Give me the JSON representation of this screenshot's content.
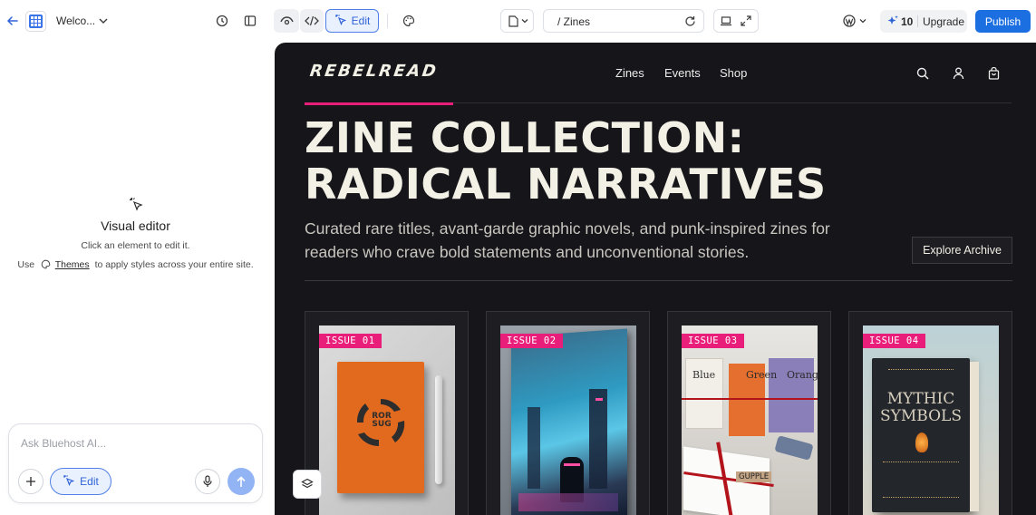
{
  "topbar": {
    "site_name": "Welco...",
    "edit_label": "Edit",
    "url_path": "/ Zines",
    "credits_count": "10",
    "upgrade_label": "Upgrade",
    "publish_label": "Publish",
    "accent_color": "#1c6fe0"
  },
  "left_panel": {
    "title": "Visual editor",
    "subtitle": "Click an element to edit it.",
    "use_prefix": "Use",
    "themes_link": "Themes",
    "use_suffix": "to apply styles across your entire site.",
    "chat_placeholder": "Ask Bluehost AI...",
    "chat_edit_label": "Edit"
  },
  "site": {
    "brand": "REBELREAD",
    "nav": [
      "Zines",
      "Events",
      "Shop"
    ],
    "hero_line1": "ZINE COLLECTION:",
    "hero_line2": "RADICAL NARRATIVES",
    "lede": "Curated rare titles, avant-garde graphic novels, and punk-inspired zines for readers who crave bold statements and unconventional stories.",
    "archive_button": "Explore Archive",
    "accent_color": "#e91e7a",
    "cards": [
      {
        "tag": "ISSUE 01",
        "book_text": "ROR SUG"
      },
      {
        "tag": "ISSUE 02"
      },
      {
        "tag": "ISSUE 03",
        "labels": [
          "Blue",
          "Green",
          "Orange"
        ],
        "box_label": "GUPPLE"
      },
      {
        "tag": "ISSUE 04",
        "title_line1": "MYTHIC",
        "title_line2": "SYMBOLS"
      }
    ]
  }
}
